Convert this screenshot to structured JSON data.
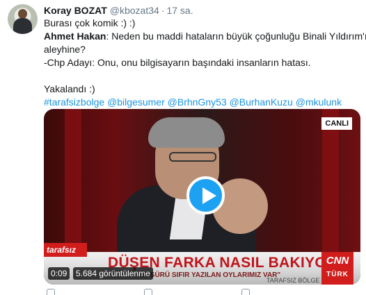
{
  "tweet": {
    "author_name": "Koray BOZAT",
    "author_handle": "@kbozat34",
    "separator": "·",
    "timestamp": "17 sa.",
    "lines": {
      "line1": "Burası çok komik :) :)",
      "line2_bold": "Ahmet Hakan",
      "line2_rest": ": Neden bu maddi hataların büyük çoğunluğu Binali Yıldırım'ın",
      "line3": "aleyhine?",
      "line4": "-Chp Adayı: Onu, onu bilgisayarın başındaki insanların hatası.",
      "line5": "Yakalandı :)"
    },
    "tags": [
      "#tarafsizbolge",
      "@bilgesumer",
      "@BrhnGny53",
      "@BurhanKuzu",
      "@mkulunk"
    ]
  },
  "video": {
    "live_badge": "CANLI",
    "program_tab": "tarafsız",
    "headline": "DÜŞEN FARKA NASIL BAKIYOR?",
    "subline": "IR SÜRÜ SIFIR YAZILAN OYLARIMIZ VAR\"",
    "footer_tag": "TARAFSIZ BÖLGE",
    "channel_logo_top": "CNN",
    "channel_logo_bottom": "TÜRK",
    "duration": "0:09",
    "views": "5.684 görüntülenme",
    "play_icon": "play-icon"
  },
  "colors": {
    "link": "#1b95e0",
    "play": "#1da1f2",
    "brand_red": "#d21d1d"
  }
}
